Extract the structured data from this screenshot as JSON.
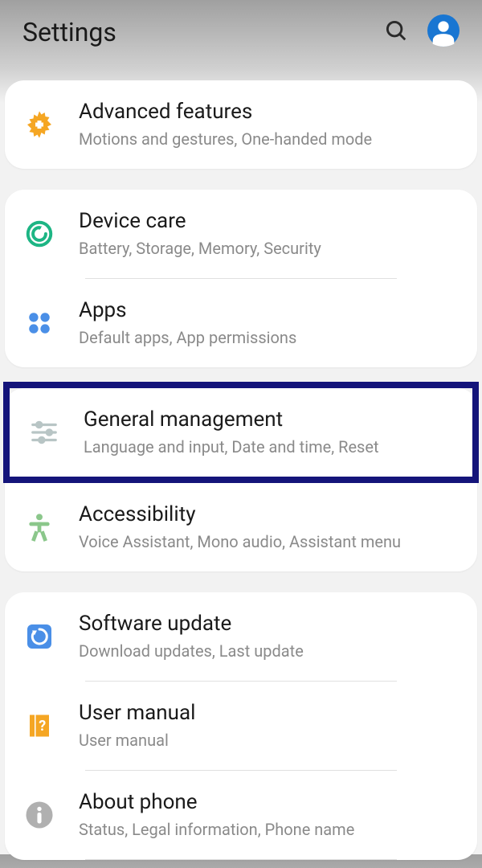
{
  "header": {
    "title": "Settings"
  },
  "groups": [
    {
      "items": [
        {
          "icon": "gear-plus",
          "title": "Advanced features",
          "sub": "Motions and gestures, One-handed mode"
        }
      ]
    },
    {
      "items": [
        {
          "icon": "device-care",
          "title": "Device care",
          "sub": "Battery, Storage, Memory, Security"
        },
        {
          "icon": "apps",
          "title": "Apps",
          "sub": "Default apps, App permissions"
        }
      ]
    },
    {
      "items": [
        {
          "icon": "sliders",
          "title": "General management",
          "sub": "Language and input, Date and time, Reset",
          "highlighted": true
        },
        {
          "icon": "accessibility",
          "title": "Accessibility",
          "sub": "Voice Assistant, Mono audio, Assistant menu"
        }
      ]
    },
    {
      "items": [
        {
          "icon": "update",
          "title": "Software update",
          "sub": "Download updates, Last update"
        },
        {
          "icon": "manual",
          "title": "User manual",
          "sub": "User manual"
        },
        {
          "icon": "info",
          "title": "About phone",
          "sub": "Status, Legal information, Phone name"
        }
      ]
    }
  ]
}
